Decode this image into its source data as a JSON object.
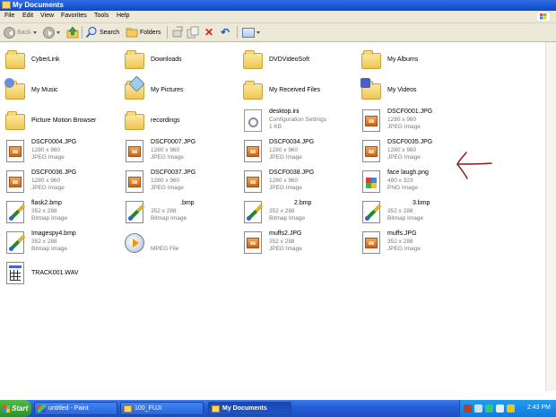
{
  "window": {
    "title": "My Documents"
  },
  "menu": [
    "File",
    "Edit",
    "View",
    "Favorites",
    "Tools",
    "Help"
  ],
  "toolbar": {
    "back_label": "Back",
    "search_label": "Search",
    "folders_label": "Folders"
  },
  "items": [
    {
      "name": "CyberLink",
      "type": "folder"
    },
    {
      "name": "Downloads",
      "type": "folder"
    },
    {
      "name": "DVDVideoSoft",
      "type": "folder"
    },
    {
      "name": "My Albums",
      "type": "folder"
    },
    {
      "name": "My Music",
      "type": "folder"
    },
    {
      "name": "My Pictures",
      "type": "folder"
    },
    {
      "name": "My Received Files",
      "type": "folder"
    },
    {
      "name": "My Videos",
      "type": "folder"
    },
    {
      "name": "Picture Motion Browser",
      "type": "folder"
    },
    {
      "name": "recordings",
      "type": "folder"
    },
    {
      "name": "desktop.ini",
      "line1": "Configuration Settings",
      "line2": "1 KB",
      "type": "ini"
    },
    {
      "name": "DSCF0001.JPG",
      "line1": "1280 x 960",
      "line2": "JPEG Image",
      "type": "jpg"
    },
    {
      "name": "DSCF0004.JPG",
      "line1": "1280 x 960",
      "line2": "JPEG Image",
      "type": "jpg"
    },
    {
      "name": "DSCF0007.JPG",
      "line1": "1280 x 960",
      "line2": "JPEG Image",
      "type": "jpg"
    },
    {
      "name": "DSCF0034.JPG",
      "line1": "1280 x 960",
      "line2": "JPEG Image",
      "type": "jpg"
    },
    {
      "name": "DSCF0035.JPG",
      "line1": "1280 x 960",
      "line2": "JPEG Image",
      "type": "jpg"
    },
    {
      "name": "DSCF0036.JPG",
      "line1": "1280 x 960",
      "line2": "JPEG Image",
      "type": "jpg"
    },
    {
      "name": "DSCF0037.JPG",
      "line1": "1280 x 960",
      "line2": "JPEG Image",
      "type": "jpg"
    },
    {
      "name": "DSCF0038.JPG",
      "line1": "1280 x 960",
      "line2": "JPEG Image",
      "type": "jpg"
    },
    {
      "name": "face laugh.png",
      "line1": "480 x 323",
      "line2": "PNG Image",
      "type": "png"
    },
    {
      "name": "flask2.bmp",
      "line1": "352 x 288",
      "line2": "Bitmap Image",
      "type": "bmp"
    },
    {
      "name": ".bmp",
      "line1": "352 x 288",
      "line2": "Bitmap Image",
      "type": "bmp"
    },
    {
      "name": "2.bmp",
      "line1": "352 x 288",
      "line2": "Bitmap Image",
      "type": "bmp"
    },
    {
      "name": "3.bmp",
      "line1": "352 x 288",
      "line2": "Bitmap Image",
      "type": "bmp"
    },
    {
      "name": "Imagespy4.bmp",
      "line1": "352 x 288",
      "line2": "Bitmap Image",
      "type": "bmp"
    },
    {
      "name": "",
      "line1": "MPEG File",
      "line2": "",
      "type": "mpeg"
    },
    {
      "name": "muffs2.JPG",
      "line1": "352 x 288",
      "line2": "JPEG Image",
      "type": "jpg"
    },
    {
      "name": "muffs.JPG",
      "line1": "352 x 288",
      "line2": "JPEG Image",
      "type": "jpg"
    },
    {
      "name": "TRACK001.WAV",
      "type": "wav"
    }
  ],
  "taskbar": {
    "start_label": "Start",
    "tasks": [
      {
        "label": "untitled - Paint",
        "active": false
      },
      {
        "label": "100_FUJI",
        "active": false
      },
      {
        "label": "My Documents",
        "active": true
      }
    ],
    "clock": "2:43 PM"
  },
  "colors": {
    "titlebar": "#0b49c9",
    "taskbar": "#245ed8",
    "start": "#2e8f2b",
    "annotation": "#8b1a1a"
  }
}
